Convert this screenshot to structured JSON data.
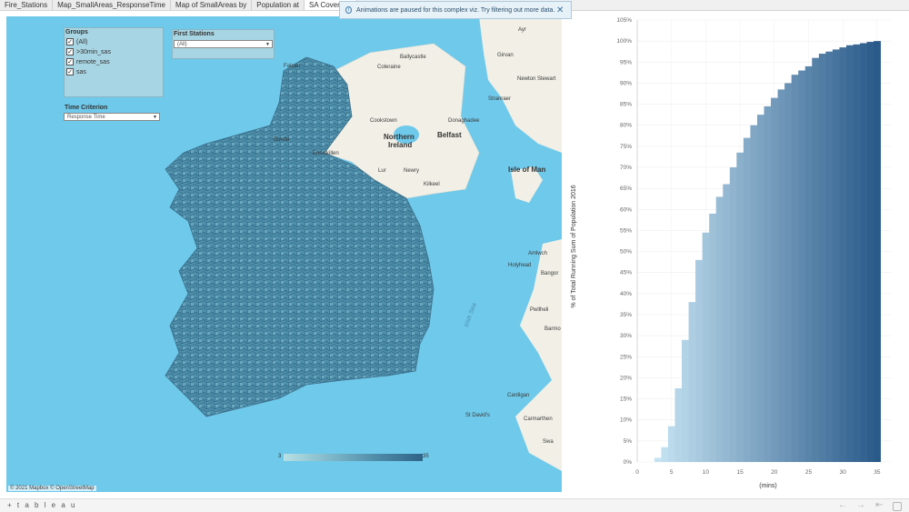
{
  "tabs": [
    {
      "label": "Fire_Stations",
      "active": false
    },
    {
      "label": "Map_SmallAreas_ResponseTime",
      "active": false
    },
    {
      "label": "Map of SmallAreas by",
      "active": false
    },
    {
      "label": "Population at",
      "active": false
    },
    {
      "label": "SA Coverage",
      "active": true
    }
  ],
  "toast": {
    "message": "Animations are paused for this complex viz. Try filtering out more data.",
    "info_icon": "info-icon",
    "close_icon": "close-icon"
  },
  "filters": {
    "groups_title": "Groups",
    "groups": [
      {
        "label": "(All)",
        "checked": true
      },
      {
        "label": ">30min_sas",
        "checked": true
      },
      {
        "label": "remote_sas",
        "checked": true
      },
      {
        "label": "sas",
        "checked": true
      }
    ],
    "first_stations_title": "First Stations",
    "first_stations_value": "(All)",
    "time_criterion_title": "Time Criterion",
    "time_criterion_value": "Response Time"
  },
  "map": {
    "labels": {
      "ayr": "Ayr",
      "girvan": "Girvan",
      "ballycastle": "Ballycastle",
      "coleraine": "Coleraine",
      "newton_stewart": "Newton Stewart",
      "stranraer": "Stranraer",
      "cookstown": "Cookstown",
      "donaghadee": "Donaghadee",
      "northern_ireland_1": "Northern",
      "northern_ireland_2": "Ireland",
      "belfast": "Belfast",
      "enniskillen": "Enniskillen",
      "newry": "Newry",
      "isle_of_man": "Isle of Man",
      "kilkeel": "Kilkeel",
      "amlwch": "Amlwch",
      "holyhead": "Holyhead",
      "bangor": "Bangor",
      "pwllheli": "Pwllheli",
      "barmouth": "Barmo",
      "cardigan": "Cardigan",
      "st_davids": "St David's",
      "carmarthen": "Carmarthen",
      "swansea": "Swa",
      "irish_sea": "Irish Sea",
      "lurgan": "Lur",
      "bundoran": "Bunde",
      "falcarragh": "Falcarr"
    },
    "scale_min": "3",
    "scale_max": "35",
    "attribution": "© 2021 Mapbox © OpenStreetMap",
    "colors": {
      "water": "#6fc9ea",
      "land": "#f1efe6",
      "area_fill": "#4d8fad",
      "area_edge": "#2e5f7a"
    }
  },
  "chart_data": {
    "type": "bar",
    "title": "",
    "xlabel": "(mins)",
    "ylabel": "% of Total Running Sum of Population 2016",
    "x": [
      3,
      4,
      5,
      6,
      7,
      8,
      9,
      10,
      11,
      12,
      13,
      14,
      15,
      16,
      17,
      18,
      19,
      20,
      21,
      22,
      23,
      24,
      25,
      26,
      27,
      28,
      29,
      30,
      31,
      32,
      33,
      34,
      35
    ],
    "values": [
      1,
      3.5,
      8.5,
      17.5,
      29,
      38,
      48,
      54.5,
      59,
      63,
      66,
      70,
      73.5,
      77,
      80,
      82.5,
      84.5,
      86.5,
      88.5,
      90,
      92,
      93,
      94,
      96,
      97,
      97.5,
      98,
      98.5,
      99,
      99.2,
      99.5,
      99.8,
      100
    ],
    "xticks": [
      0,
      5,
      10,
      15,
      20,
      25,
      30,
      35
    ],
    "yticks": [
      "0%",
      "5%",
      "10%",
      "15%",
      "20%",
      "25%",
      "30%",
      "35%",
      "40%",
      "45%",
      "50%",
      "55%",
      "60%",
      "65%",
      "70%",
      "75%",
      "80%",
      "85%",
      "90%",
      "95%",
      "100%",
      "105%"
    ],
    "xlim": [
      0,
      37
    ],
    "ylim": [
      0,
      105
    ],
    "grid": true,
    "color_low": "#c5e3f2",
    "color_high": "#2a5a8a"
  },
  "footer": {
    "logo": "+ t a b l e a u",
    "nav_prev": "←",
    "nav_next": "→",
    "nav_first": "⇤",
    "share": "share-icon"
  }
}
